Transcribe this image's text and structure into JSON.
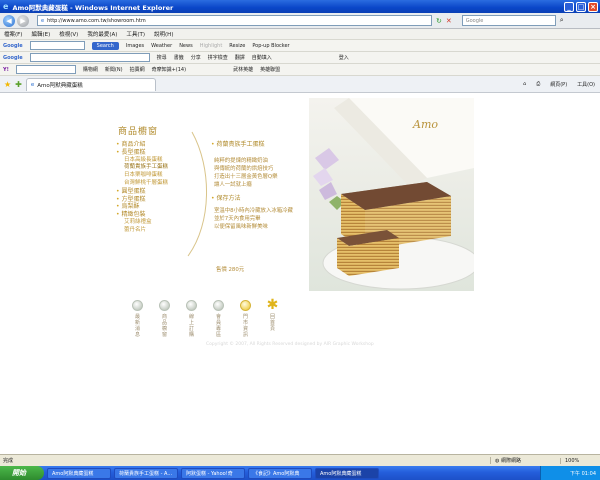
{
  "window": {
    "title": "Amo阿默典藏蛋糕 - Windows Internet Explorer"
  },
  "address": {
    "url": "http://www.amo.com.tw/showroom.htm",
    "search_placeholder": "Google"
  },
  "menu": [
    "檔案(F)",
    "編輯(E)",
    "檢視(V)",
    "我的最愛(A)",
    "工具(T)",
    "說明(H)"
  ],
  "google_bar": {
    "logo": "Google",
    "search_label": "Search",
    "items": [
      "Images",
      "Weather",
      "News",
      "Highlight",
      "Resize",
      "Pop-up Blocker"
    ]
  },
  "toolbar2": {
    "items": [
      "搜尋",
      "書籤",
      "分享",
      "拼字檢查",
      "翻譯",
      "自動填入",
      "登入"
    ]
  },
  "toolbar3": {
    "items": [
      "購物網",
      "新聞(N)",
      "拍賣網",
      "奇摩知識+(14)",
      "武林英雄",
      "英雄聯盟"
    ]
  },
  "tab": {
    "label": "Amo阿默典藏蛋糕"
  },
  "tab_tools": [
    "網頁(P)",
    "工具(O)"
  ],
  "page": {
    "menu_title": "商品櫥窗",
    "nav": [
      {
        "label": "商品介紹",
        "level": 0
      },
      {
        "label": "長型蛋糕",
        "level": 0
      },
      {
        "label": "日本高級長蛋糕",
        "level": 1
      },
      {
        "label": "荷蘭貴族手工蛋糕",
        "level": 1
      },
      {
        "label": "日本栗咖啡蛋糕",
        "level": 1
      },
      {
        "label": "台灣鮮桃千層蛋糕",
        "level": 1
      },
      {
        "label": "圓型蛋糕",
        "level": 0
      },
      {
        "label": "方型蛋糕",
        "level": 0
      },
      {
        "label": "烏梨酥",
        "level": 0
      },
      {
        "label": "精緻包裝",
        "level": 0
      },
      {
        "label": "艾莉絲禮盒",
        "level": 1
      },
      {
        "label": "蕾丹名片",
        "level": 1
      }
    ],
    "product_title": "荷蘭貴族手工蛋糕",
    "description": [
      "純粹的提煉的精緻奶油",
      "與傳統的荷蘭的烘焙技巧",
      "打造出十三層金黃色層Q樂",
      "讓人一試就上癮"
    ],
    "storage_title": "保存方法",
    "storage": [
      "室溫中8小時內冷藏放入冰箱冷藏",
      "並於7天內食用完畢",
      "以便保留風味新鮮美味"
    ],
    "price": "售價 280元",
    "photo_logo": "Amo",
    "bottom_icons": [
      "最新消息",
      "商品櫥窗",
      "線上訂購",
      "會員專區",
      "門市資訊",
      "回首頁"
    ],
    "copyright": "Copyright © 2007, All Rights Reserved  designed by AIR Graphic Workshop"
  },
  "status": {
    "left": "完成",
    "zone": "網際網路",
    "zoom": "100%"
  },
  "taskbar": {
    "start": "開始",
    "buttons": [
      "Amo阿默典藏蛋糕",
      "荷蘭貴族手工蛋糕 - A...",
      "阿默蛋糕 - Yahoo!奇",
      "《食記》Amo阿默典",
      "Amo阿默典藏蛋糕"
    ],
    "clock": "下午 01:04"
  },
  "colors": {
    "gold": "#b08a2a",
    "accent": "#d4a82a"
  }
}
